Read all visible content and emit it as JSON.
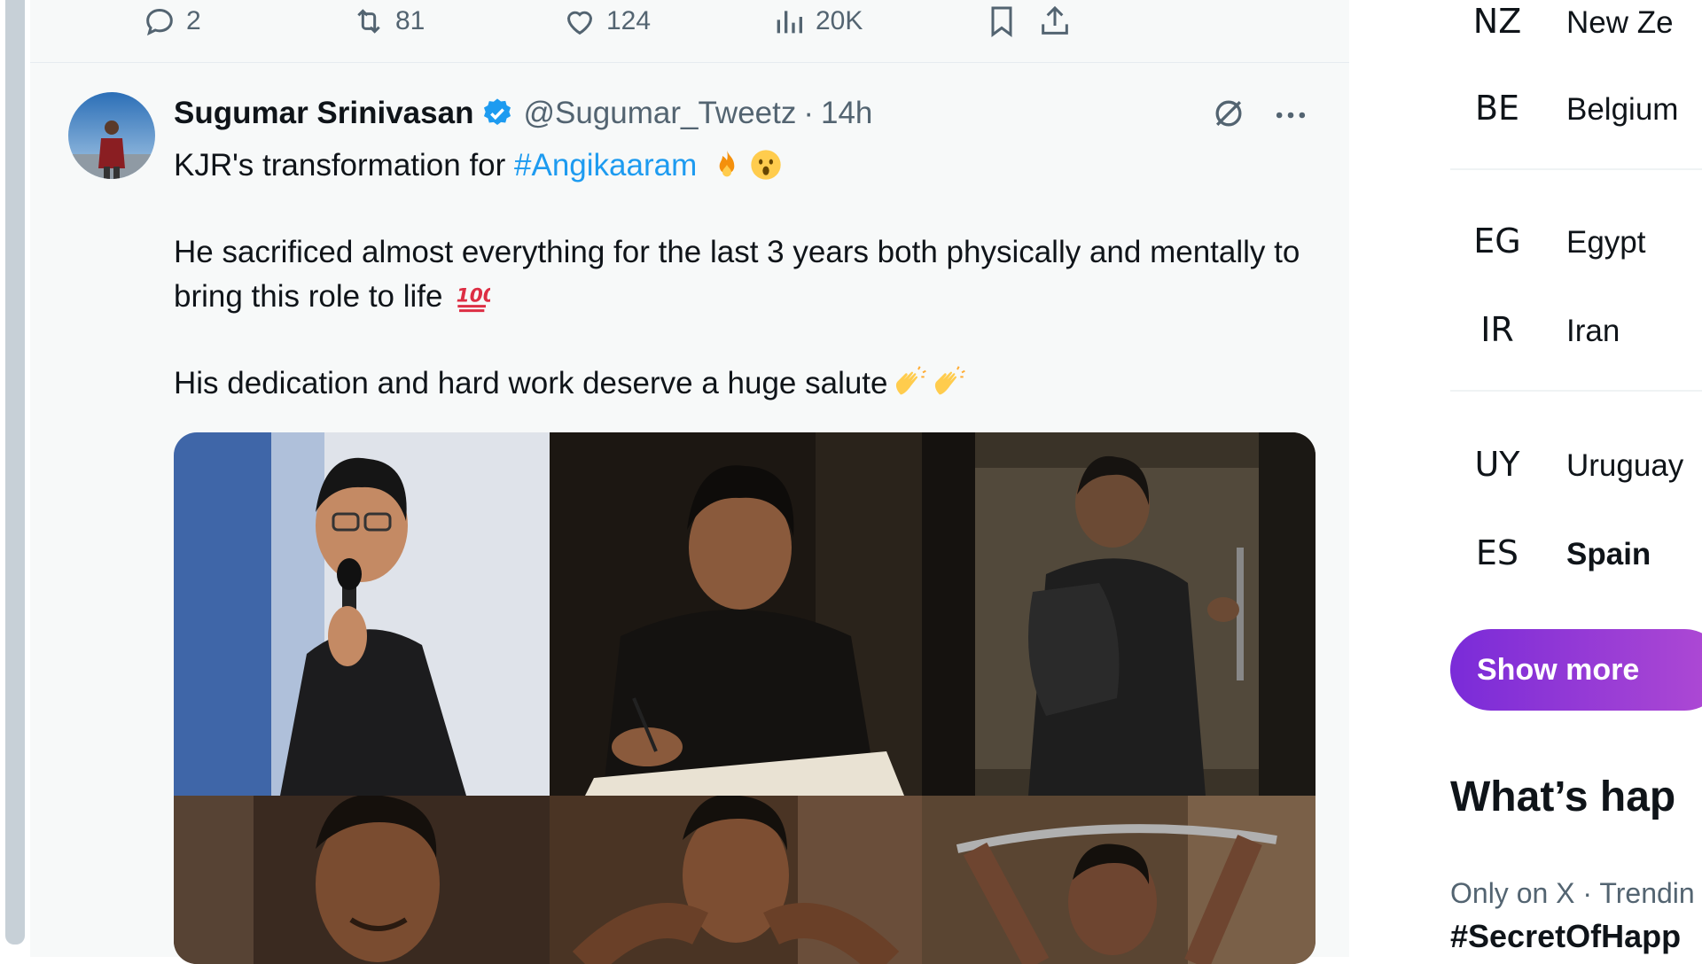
{
  "previous_tweet": {
    "actions": {
      "replies": "2",
      "reposts": "81",
      "likes": "124",
      "views": "20K"
    }
  },
  "tweet": {
    "author_name": "Sugumar Srinivasan",
    "handle": "@Sugumar_Tweetz",
    "separator": "·",
    "time": "14h",
    "line1_prefix": "KJR's transformation for ",
    "hashtag": "#Angikaaram",
    "paragraph2": "He sacrificed almost everything for the last 3 years both physically and mentally to bring this role to life",
    "paragraph3": "His dedication and hard work deserve a huge salute",
    "emojis": [
      "fire-emoji",
      "astonished-emoji",
      "hundred-points-emoji",
      "clapping-hands-emoji",
      "clapping-hands-emoji"
    ]
  },
  "sidebar": {
    "countries": [
      {
        "code": "NZ",
        "name": "New Ze"
      },
      {
        "code": "BE",
        "name": "Belgium"
      },
      {
        "code": "EG",
        "name": "Egypt"
      },
      {
        "code": "IR",
        "name": "Iran"
      },
      {
        "code": "UY",
        "name": "Uruguay"
      },
      {
        "code": "ES",
        "name": "Spain"
      }
    ],
    "show_more": "Show more",
    "whats_happening": "What’s hap",
    "trend_meta": "Only on X · Trendin",
    "trend_tag": "#SecretOfHapp"
  },
  "colors": {
    "link": "#1d9bf0",
    "secondary_text": "#536471",
    "show_more_gradient_start": "#7a2bd8",
    "show_more_gradient_end": "#b04ad3"
  }
}
